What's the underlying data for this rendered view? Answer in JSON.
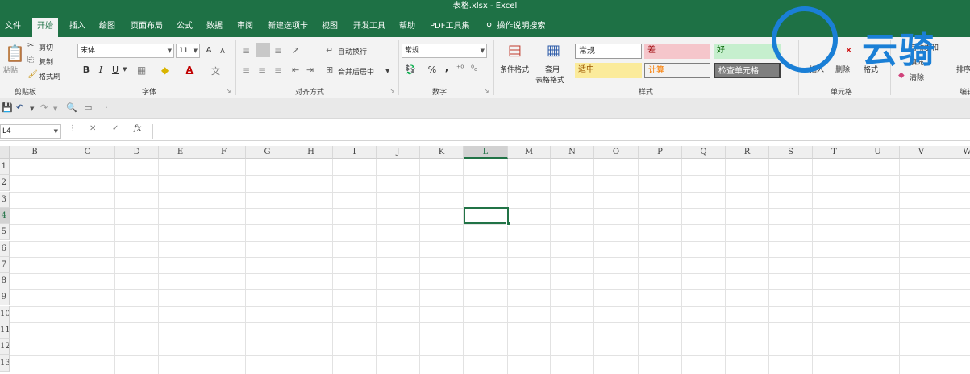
{
  "window": {
    "title": "表格.xlsx  -  Excel"
  },
  "tabs": [
    "文件",
    "开始",
    "插入",
    "绘图",
    "页面布局",
    "公式",
    "数据",
    "审阅",
    "新建选项卡",
    "视图",
    "开发工具",
    "帮助",
    "PDF工具集"
  ],
  "active_tab": "开始",
  "tell_me": "操作说明搜索",
  "ribbon": {
    "clipboard": {
      "paste": "粘贴",
      "cut": "剪切",
      "copy": "复制",
      "format_painter": "格式刷",
      "label": "剪贴板"
    },
    "font": {
      "name": "宋体",
      "size": "11",
      "bold": "B",
      "italic": "I",
      "underline": "U",
      "grow": "A",
      "shrink": "A",
      "font_color": "A",
      "label": "字体"
    },
    "alignment": {
      "wrap": "自动换行",
      "merge": "合并后居中",
      "label": "对齐方式"
    },
    "number": {
      "format": "常规",
      "percent": "%",
      "comma": ",",
      "label": "数字"
    },
    "styles": {
      "conditional": "条件格式",
      "table_line1": "套用",
      "table_line2": "表格格式",
      "cells": [
        "常规",
        "差",
        "好",
        "适中",
        "计算",
        "检查单元格"
      ],
      "label": "样式"
    },
    "cells": {
      "insert": "插入",
      "delete": "删除",
      "format": "格式",
      "label": "单元格"
    },
    "editing": {
      "autosum": "自动求和",
      "fill": "填充",
      "clear": "清除",
      "sort": "排序",
      "label": "编辑"
    }
  },
  "namebox": {
    "value": "L4"
  },
  "formula_bar": {
    "cancel": "✕",
    "enter": "✓",
    "fx": "fx"
  },
  "grid": {
    "columns": [
      "B",
      "C",
      "D",
      "E",
      "F",
      "G",
      "H",
      "I",
      "J",
      "K",
      "L",
      "M",
      "N",
      "O",
      "P",
      "Q",
      "R",
      "S",
      "T",
      "U",
      "V",
      "W"
    ],
    "rows": [
      "1",
      "2",
      "3",
      "4",
      "5",
      "6",
      "7",
      "8",
      "9",
      "10",
      "11",
      "12",
      "13"
    ],
    "selected_column": "L",
    "selected_row": "4"
  },
  "watermark": {
    "text": "云骑"
  },
  "colors": {
    "excel_green": "#1e7145",
    "selection": "#217346",
    "bad_fill": "#f5c6cb",
    "good_fill": "#c6efce",
    "neutral_fill": "#fbeb9b",
    "check_fill": "#7f7f7f"
  }
}
